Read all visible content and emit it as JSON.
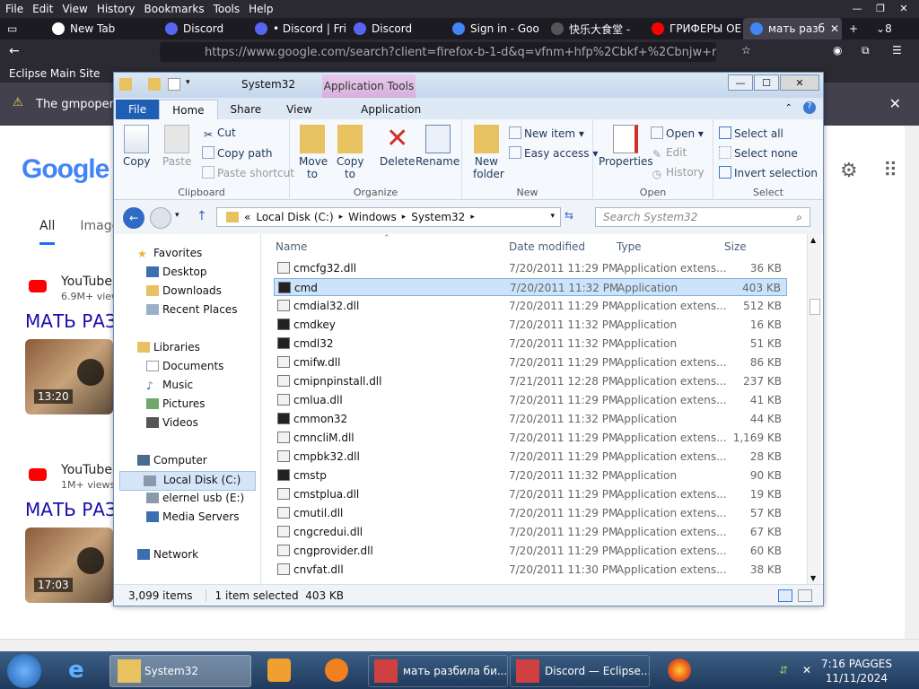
{
  "firefox": {
    "menu": [
      "File",
      "Edit",
      "View",
      "History",
      "Bookmarks",
      "Tools",
      "Help"
    ],
    "tabs": [
      {
        "label": "New Tab",
        "color": "#fff"
      },
      {
        "label": "Discord",
        "color": "#5865f2"
      },
      {
        "label": "• Discord | Fri",
        "color": "#5865f2"
      },
      {
        "label": "Discord",
        "color": "#5865f2"
      },
      {
        "label": "Sign in - Goo",
        "color": "#4285f4"
      },
      {
        "label": "快乐大食堂 -",
        "color": "#333"
      },
      {
        "label": "ГРИФЕРЫ ОЕ",
        "color": "#f00"
      },
      {
        "label": "мать разб",
        "color": "#4285f4"
      }
    ],
    "tab_count": "8",
    "url": "https://www.google.com/search?client=firefox-b-1-d&q=vfnm+hfp%2Cbkf+%2Cbnjw+rjvgm",
    "bookmark": "Eclipse Main Site",
    "notification": "The gmpopenh..."
  },
  "google": {
    "logo": "Google",
    "tabs": [
      "All",
      "Images"
    ],
    "results": [
      {
        "channel": "YouTube",
        "subs": "6.9M+ views",
        "title": "МАТЬ РАЗ",
        "duration": "13:20"
      },
      {
        "channel": "YouTube",
        "subs": "1M+ views",
        "title": "МАТЬ РАЗ",
        "duration": "17:03"
      }
    ]
  },
  "explorer": {
    "title": "System32",
    "app_tools": "Application Tools",
    "ribbon_tabs": [
      "File",
      "Home",
      "Share",
      "View",
      "Application"
    ],
    "ribbon": {
      "copy": "Copy",
      "paste": "Paste",
      "cut": "Cut",
      "copy_path": "Copy path",
      "paste_shortcut": "Paste shortcut",
      "move_to": "Move\nto",
      "copy_to": "Copy\nto",
      "delete": "Delete",
      "rename": "Rename",
      "new_folder": "New\nfolder",
      "new_item": "New item",
      "easy_access": "Easy access",
      "properties": "Properties",
      "open": "Open",
      "edit": "Edit",
      "history": "History",
      "select_all": "Select all",
      "select_none": "Select none",
      "invert_selection": "Invert selection",
      "groups": [
        "Clipboard",
        "Organize",
        "New",
        "Open",
        "Select"
      ]
    },
    "address": [
      "«",
      "Local Disk (C:)",
      "Windows",
      "System32"
    ],
    "search_placeholder": "Search System32",
    "nav": {
      "favorites": "Favorites",
      "desktop": "Desktop",
      "downloads": "Downloads",
      "recent": "Recent Places",
      "libraries": "Libraries",
      "documents": "Documents",
      "music": "Music",
      "pictures": "Pictures",
      "videos": "Videos",
      "computer": "Computer",
      "local_disk": "Local Disk (C:)",
      "usb": "elernel usb (E:)",
      "media": "Media Servers",
      "network": "Network"
    },
    "columns": [
      "Name",
      "Date modified",
      "Type",
      "Size"
    ],
    "files": [
      {
        "name": "cmcfg32.dll",
        "date": "7/20/2011 11:29 PM",
        "type": "Application extens...",
        "size": "36 KB"
      },
      {
        "name": "cmd",
        "date": "7/20/2011 11:32 PM",
        "type": "Application",
        "size": "403 KB"
      },
      {
        "name": "cmdial32.dll",
        "date": "7/20/2011 11:29 PM",
        "type": "Application extens...",
        "size": "512 KB"
      },
      {
        "name": "cmdkey",
        "date": "7/20/2011 11:32 PM",
        "type": "Application",
        "size": "16 KB"
      },
      {
        "name": "cmdl32",
        "date": "7/20/2011 11:32 PM",
        "type": "Application",
        "size": "51 KB"
      },
      {
        "name": "cmifw.dll",
        "date": "7/20/2011 11:29 PM",
        "type": "Application extens...",
        "size": "86 KB"
      },
      {
        "name": "cmipnpinstall.dll",
        "date": "7/21/2011 12:28 PM",
        "type": "Application extens...",
        "size": "237 KB"
      },
      {
        "name": "cmlua.dll",
        "date": "7/20/2011 11:29 PM",
        "type": "Application extens...",
        "size": "41 KB"
      },
      {
        "name": "cmmon32",
        "date": "7/20/2011 11:32 PM",
        "type": "Application",
        "size": "44 KB"
      },
      {
        "name": "cmncliM.dll",
        "date": "7/20/2011 11:29 PM",
        "type": "Application extens...",
        "size": "1,169 KB"
      },
      {
        "name": "cmpbk32.dll",
        "date": "7/20/2011 11:29 PM",
        "type": "Application extens...",
        "size": "28 KB"
      },
      {
        "name": "cmstp",
        "date": "7/20/2011 11:32 PM",
        "type": "Application",
        "size": "90 KB"
      },
      {
        "name": "cmstplua.dll",
        "date": "7/20/2011 11:29 PM",
        "type": "Application extens...",
        "size": "19 KB"
      },
      {
        "name": "cmutil.dll",
        "date": "7/20/2011 11:29 PM",
        "type": "Application extens...",
        "size": "57 KB"
      },
      {
        "name": "cngcredui.dll",
        "date": "7/20/2011 11:29 PM",
        "type": "Application extens...",
        "size": "67 KB"
      },
      {
        "name": "cngprovider.dll",
        "date": "7/20/2011 11:29 PM",
        "type": "Application extens...",
        "size": "60 KB"
      },
      {
        "name": "cnvfat.dll",
        "date": "7/20/2011 11:30 PM",
        "type": "Application extens...",
        "size": "38 KB"
      }
    ],
    "status": {
      "items": "3,099 items",
      "selected": "1 item selected  403 KB"
    }
  },
  "taskbar": {
    "buttons": [
      "System32",
      "мать разбила би...",
      "Discord — Eclipse..."
    ],
    "clock_time": "7:16 PAGGES",
    "clock_date": "11/11/2024"
  }
}
